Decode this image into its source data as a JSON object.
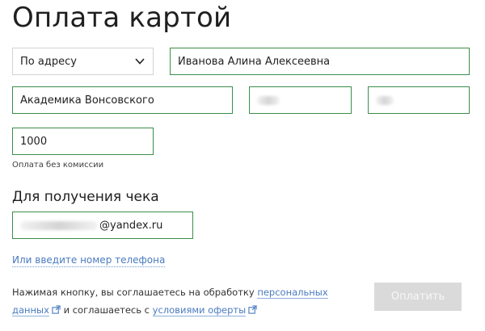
{
  "page": {
    "title": "Оплата картой"
  },
  "form": {
    "address_select": {
      "value": "По адресу"
    },
    "full_name": {
      "value": "Иванова Алина Алексеевна"
    },
    "street": {
      "value": "Академика Вонсовского"
    },
    "amount": {
      "value": "1000",
      "note": "Оплата без комиссии"
    }
  },
  "receipt": {
    "heading": "Для получения чека",
    "email_suffix": "@yandex.ru",
    "phone_link": "Или введите номер телефона"
  },
  "consent": {
    "part1": "Нажимая кнопку, вы соглашаетесь на обработку ",
    "link1": "персональных данных",
    "part2": " и соглашаетесь с ",
    "link2": "условиями оферты"
  },
  "actions": {
    "pay_label": "Оплатить"
  },
  "colors": {
    "accent_border": "#3a8f4a",
    "link": "#4a7bbf",
    "button_disabled": "#dadada"
  },
  "icons": {
    "select_arrow": "chevron-down-icon",
    "external": "external-link-icon"
  }
}
